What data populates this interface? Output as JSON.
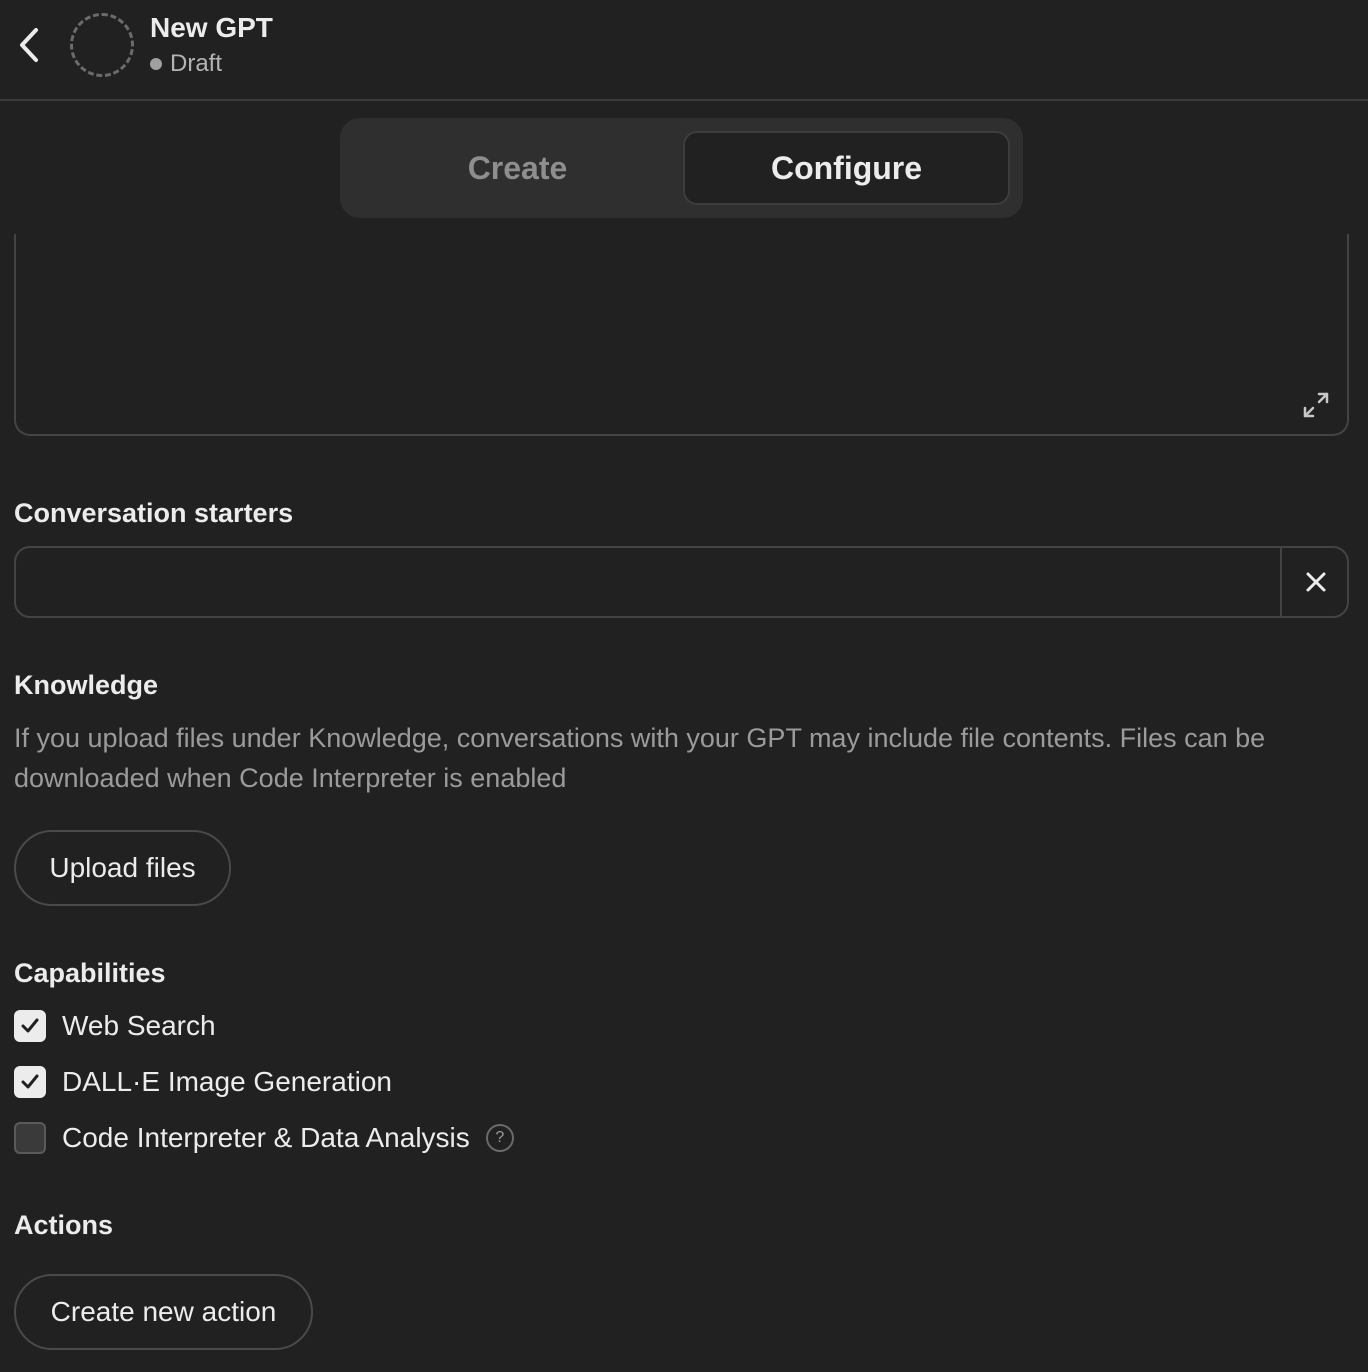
{
  "header": {
    "title": "New GPT",
    "status": "Draft"
  },
  "tabs": [
    {
      "label": "Create",
      "active": false
    },
    {
      "label": "Configure",
      "active": true
    }
  ],
  "conversation_starters": {
    "label": "Conversation starters",
    "value": ""
  },
  "knowledge": {
    "label": "Knowledge",
    "description": "If you upload files under Knowledge, conversations with your GPT may include file contents. Files can be downloaded when Code Interpreter is enabled",
    "upload_button": "Upload files"
  },
  "capabilities": {
    "label": "Capabilities",
    "items": [
      {
        "label": "Web Search",
        "checked": true
      },
      {
        "label": "DALL·E Image Generation",
        "checked": true
      },
      {
        "label": "Code Interpreter & Data Analysis",
        "checked": false,
        "help": "?"
      }
    ]
  },
  "actions": {
    "label": "Actions",
    "create_button": "Create new action"
  }
}
